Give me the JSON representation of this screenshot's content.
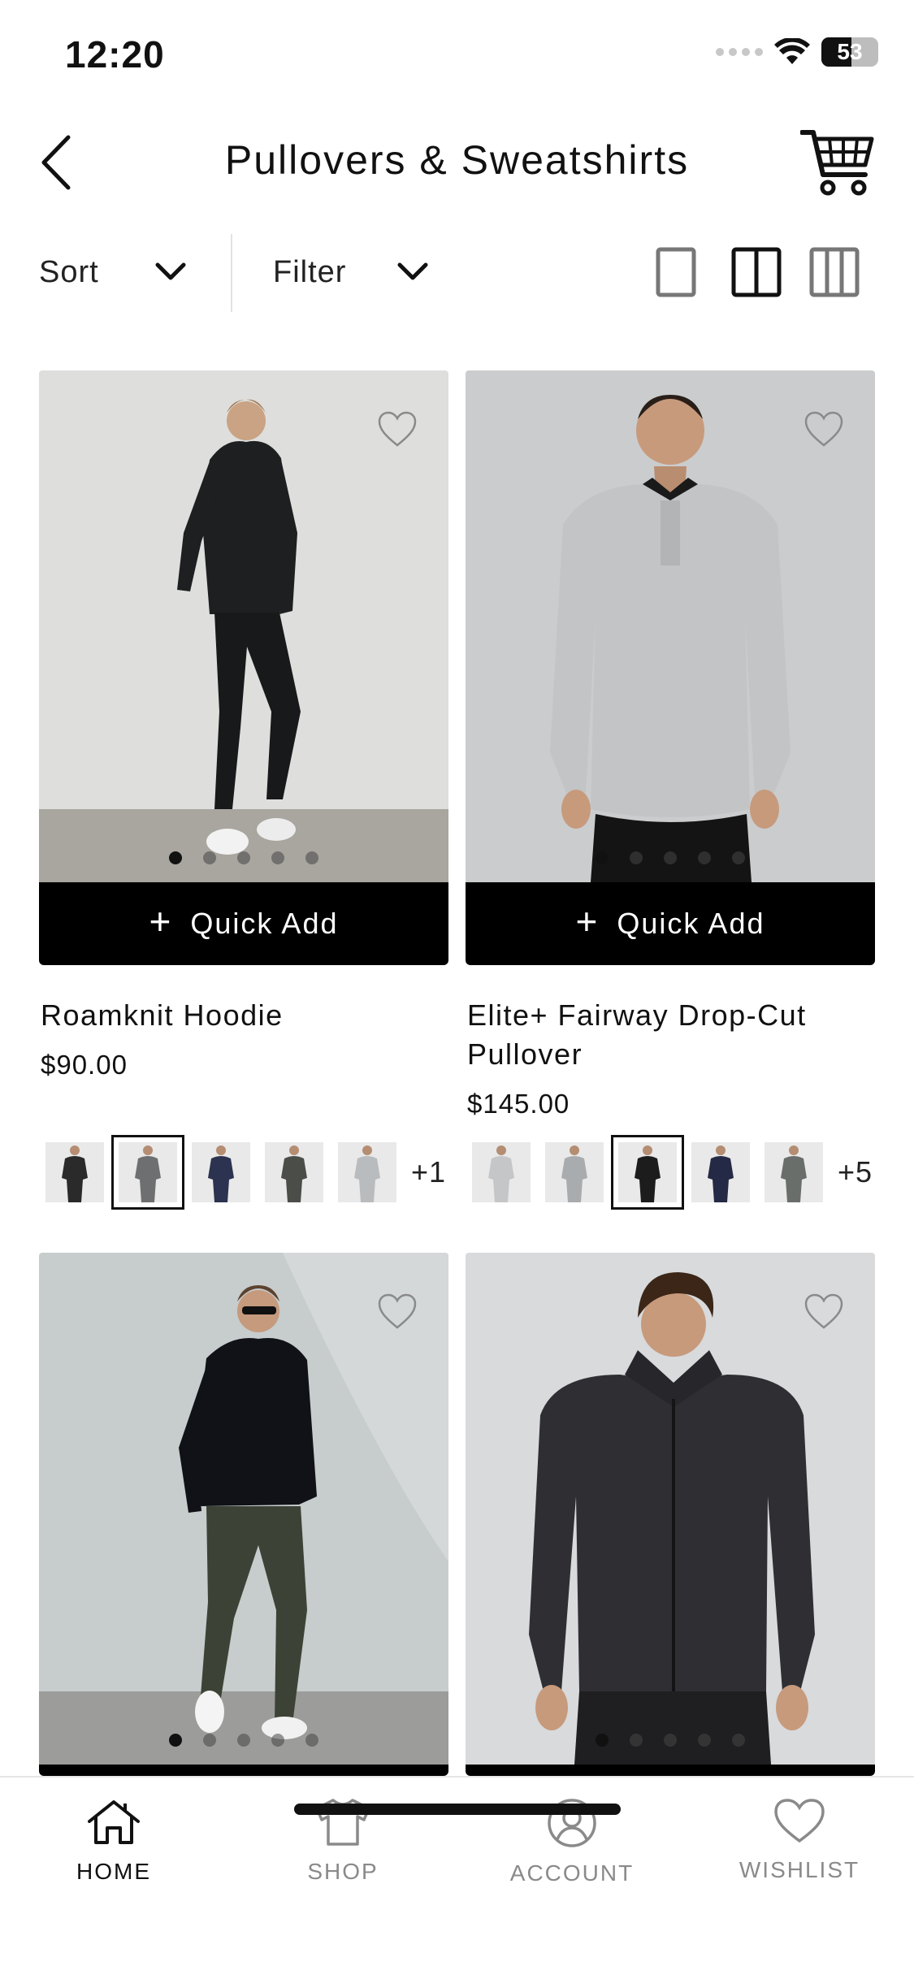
{
  "status_bar": {
    "time": "12:20",
    "battery_percent": "53",
    "battery_level": 0.53
  },
  "header": {
    "title": "Pullovers & Sweatshirts",
    "back_icon": "chevron-left-icon",
    "cart_icon": "shopping-cart-icon"
  },
  "toolbar": {
    "sort_label": "Sort",
    "filter_label": "Filter",
    "view_options": [
      "single-column-icon",
      "two-column-icon",
      "three-column-icon"
    ],
    "selected_view": "two-column-icon"
  },
  "products": [
    {
      "name": "Roamknit Hoodie",
      "price": "$90.00",
      "quick_add_label": "Quick Add",
      "image_count": 5,
      "active_image": 1,
      "swatch_more": "+1",
      "swatch_colors": [
        "#2a2a2a",
        "#6d6f70",
        "#2c3350",
        "#4a4d48",
        "#b9bcbf"
      ],
      "selected_swatch": 2,
      "background": "#dcdcdc"
    },
    {
      "name": "Elite+ Fairway Drop-Cut Pullover",
      "price": "$145.00",
      "quick_add_label": "Quick Add",
      "image_count": 5,
      "active_image": 1,
      "swatch_more": "+5",
      "swatch_colors": [
        "#c4c6c8",
        "#a9acaf",
        "#1c1c1c",
        "#242a45",
        "#6a6e6a"
      ],
      "selected_swatch": 3,
      "background": "#c9cacb"
    },
    {
      "name": "",
      "price": "",
      "image_count": 5,
      "active_image": 1,
      "background": "#c6cbcd"
    },
    {
      "name": "",
      "price": "",
      "image_count": 5,
      "active_image": 1,
      "background": "#d7d9db"
    }
  ],
  "tabbar": {
    "items": [
      {
        "label": "HOME",
        "icon": "home-icon",
        "active": true
      },
      {
        "label": "SHOP",
        "icon": "shirt-icon",
        "active": false
      },
      {
        "label": "ACCOUNT",
        "icon": "account-icon",
        "active": false
      },
      {
        "label": "WISHLIST",
        "icon": "heart-icon",
        "active": false
      }
    ]
  }
}
